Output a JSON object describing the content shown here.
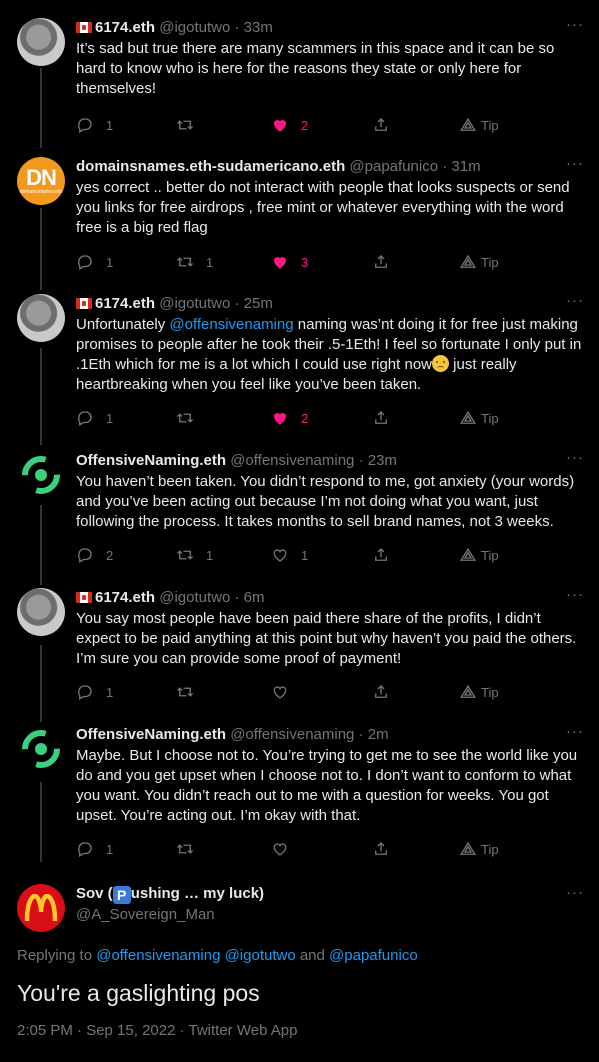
{
  "colors": {
    "background": "#000000",
    "text": "#e7e9ea",
    "muted": "#71767b",
    "link": "#1d9bf0",
    "like": "#f91880"
  },
  "tweets": [
    {
      "name": "6174.eth",
      "handle": "@igotutwo",
      "time": "· 33m",
      "text": "It’s sad but true there are many scammers in this space and it can be so hard to know who is here for the reasons they state or only here for themselves!",
      "replies": "1",
      "retweets": "",
      "likes": "2",
      "tip": "Tip",
      "liked": true
    },
    {
      "name": "domainsnames.eth-sudamericano.eth",
      "handle": "@papafunico",
      "time": "· 31m",
      "avatar_text": "DN",
      "avatar_sub": "domainsnames.eth",
      "text": "yes correct .. better do not interact with people that looks suspects or send you links for free airdrops , free mint or whatever everything with the word free is a big red flag",
      "replies": "1",
      "retweets": "1",
      "likes": "3",
      "tip": "Tip",
      "liked": true
    },
    {
      "name": "6174.eth",
      "handle": "@igotutwo",
      "time": "· 25m",
      "text_pre": "Unfortunately ",
      "mention": "@offensivenaming",
      "text_mid": " naming was’nt doing it for free just making promises to people after he took their .5-1Eth!  I feel so fortunate I only put in .1Eth which for me is a lot which I could use right now",
      "text_post": " just really heartbreaking when you feel like you’ve been taken.",
      "replies": "1",
      "retweets": "",
      "likes": "2",
      "tip": "Tip",
      "liked": true
    },
    {
      "name": "OffensiveNaming.eth",
      "handle": "@offensivenaming",
      "time": "· 23m",
      "text": "You haven’t been taken. You didn’t respond to me, got anxiety (your words) and you’ve been acting out because I’m not doing what you want, just following the process. It takes months to sell brand names, not 3 weeks.",
      "replies": "2",
      "retweets": "1",
      "likes": "1",
      "tip": "Tip",
      "liked": false
    },
    {
      "name": "6174.eth",
      "handle": "@igotutwo",
      "time": "· 6m",
      "text": "You say most people have been paid there share of the profits, I didn’t expect to be paid anything at this point but why haven’t you paid the others.  I’m sure you can provide some proof of payment!",
      "replies": "1",
      "retweets": "",
      "likes": "",
      "tip": "Tip",
      "liked": false
    },
    {
      "name": "OffensiveNaming.eth",
      "handle": "@offensivenaming",
      "time": "· 2m",
      "text": "Maybe. But I choose not to. You’re trying to get me to see the world like you do and you get upset when I choose not to. I don’t want to conform to what you want. You didn’t reach out to me with a question for weeks. You got upset. You’re acting out. I’m okay with that.",
      "replies": "1",
      "retweets": "",
      "likes": "",
      "tip": "Tip",
      "liked": false
    }
  ],
  "main": {
    "name_pre": "Sov (",
    "badge": "P",
    "name_post": "ushing … my luck)",
    "handle": "@A_Sovereign_Man",
    "replying_label": "Replying to ",
    "replying_mentions": "@offensivenaming @igotutwo",
    "replying_and": " and ",
    "replying_last": "@papafunico",
    "text": "You're a gaslighting pos",
    "timestamp": "2:05 PM · Sep 15, 2022 · Twitter Web App"
  },
  "more_label": "···"
}
